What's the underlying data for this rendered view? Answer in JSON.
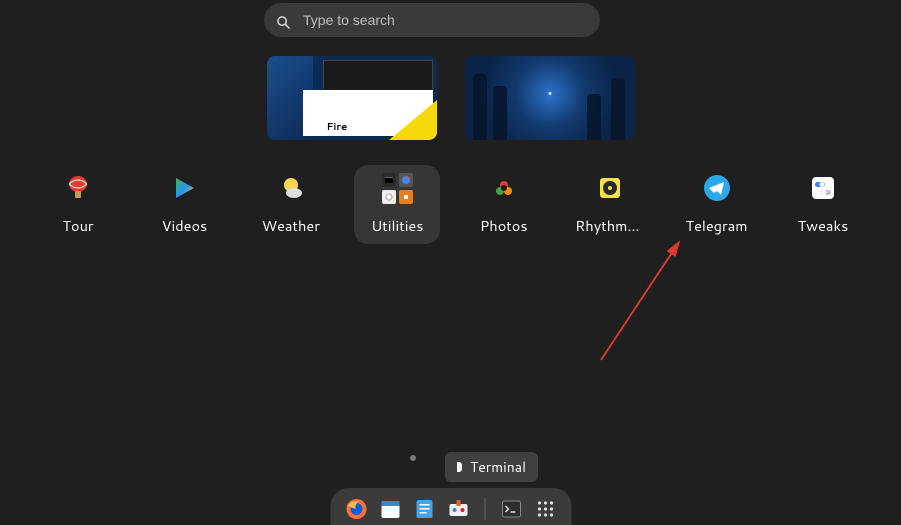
{
  "search": {
    "placeholder": "Type to search"
  },
  "apps": [
    {
      "label": "Tour"
    },
    {
      "label": "Videos"
    },
    {
      "label": "Weather"
    },
    {
      "label": "Utilities"
    },
    {
      "label": "Photos"
    },
    {
      "label": "Rhythmbox"
    },
    {
      "label": "Telegram"
    },
    {
      "label": "Tweaks"
    }
  ],
  "tooltip": {
    "label": "Terminal"
  },
  "workspace1_overlay": "Fire"
}
